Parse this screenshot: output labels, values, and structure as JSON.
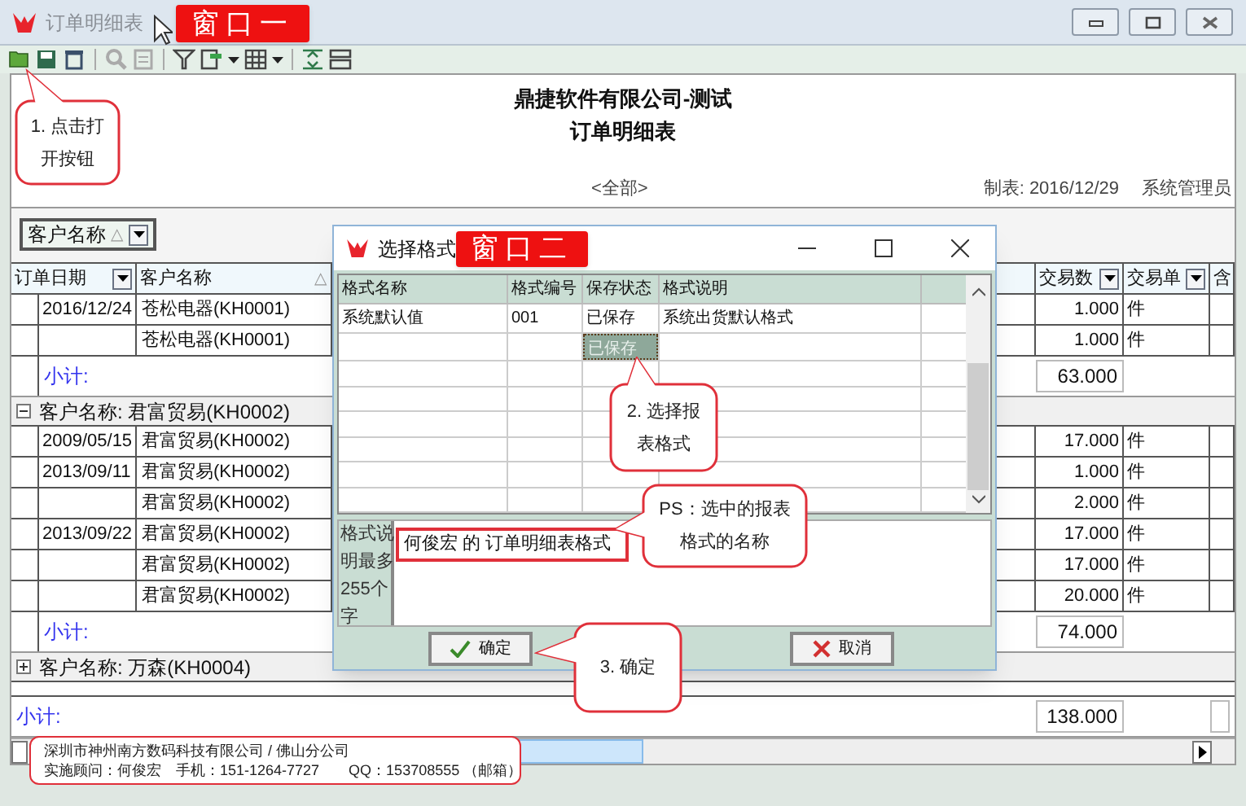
{
  "window": {
    "title": "订单明细表",
    "label": "窗口一"
  },
  "report": {
    "company": "鼎捷软件有限公司-测试",
    "title": "订单明细表",
    "filter": "<全部>",
    "prepared": "制表: 2016/12/29",
    "user": "系统管理员"
  },
  "group_by": {
    "field": "客户名称",
    "sort_mark": "△",
    "dropdown": true
  },
  "table": {
    "columns": [
      {
        "label": "订单日期",
        "dropdown": true
      },
      {
        "label": "客户名称",
        "sort_mark": "△",
        "dropdown": false
      },
      {
        "label": "交易数",
        "dropdown": true
      },
      {
        "label": "交易单",
        "dropdown": true
      },
      {
        "label": "含",
        "dropdown": false
      }
    ],
    "rows": [
      {
        "kind": "item",
        "date": "2016/12/24",
        "customer": "苍松电器(KH0001)",
        "qty": "1.000",
        "unit": "件"
      },
      {
        "kind": "item",
        "customer": "苍松电器(KH0001)",
        "qty": "1.000",
        "unit": "件"
      },
      {
        "kind": "subtotal",
        "label": "小计:",
        "qty": "63.000"
      },
      {
        "kind": "group",
        "label": "客户名称: 君富贸易(KH0002)",
        "expanded": true
      },
      {
        "kind": "item",
        "date": "2009/05/15",
        "customer": "君富贸易(KH0002)",
        "qty": "17.000",
        "unit": "件"
      },
      {
        "kind": "item",
        "date": "2013/09/11",
        "customer": "君富贸易(KH0002)",
        "qty": "1.000",
        "unit": "件"
      },
      {
        "kind": "item",
        "customer": "君富贸易(KH0002)",
        "qty": "2.000",
        "unit": "件"
      },
      {
        "kind": "item",
        "date": "2013/09/22",
        "customer": "君富贸易(KH0002)",
        "qty": "17.000",
        "unit": "件"
      },
      {
        "kind": "item",
        "customer": "君富贸易(KH0002)",
        "qty": "17.000",
        "unit": "件"
      },
      {
        "kind": "item",
        "customer": "君富贸易(KH0002)",
        "qty": "20.000",
        "unit": "件"
      },
      {
        "kind": "subtotal",
        "label": "小计:",
        "qty": "74.000"
      },
      {
        "kind": "group",
        "label": "客户名称: 万森(KH0004)",
        "expanded": false
      },
      {
        "kind": "blank"
      },
      {
        "kind": "total",
        "label": "小计:",
        "qty": "138.000"
      }
    ]
  },
  "dialog": {
    "title": "选择格式",
    "label": "窗口二",
    "columns": [
      "格式名称",
      "格式编号",
      "保存状态",
      "格式说明"
    ],
    "rows": [
      {
        "name": "系统默认值",
        "code": "001",
        "status": "已保存",
        "description": "系统出货默认格式",
        "selected": false
      },
      {
        "status": "已保存",
        "selected": true
      }
    ],
    "description_label": [
      "格式说",
      "明最多",
      "255个",
      "字"
    ],
    "description_value": "何俊宏 的 订单明细表格式",
    "buttons": [
      {
        "kind": "ok",
        "label": "确定"
      },
      {
        "kind": "cancel",
        "label": "取消"
      }
    ]
  },
  "callouts": [
    {
      "lines": [
        "1. 点击打",
        "开按钮"
      ]
    },
    {
      "lines": [
        "2. 选择报",
        "表格式"
      ]
    },
    {
      "lines": [
        "PS：选中的报表",
        "格式的名称"
      ]
    },
    {
      "lines": [
        "3. 确定"
      ]
    }
  ],
  "footer_note": {
    "lines": [
      "深圳市神州南方数码科技有限公司 / 佛山分公司",
      "实施顾问：何俊宏　手机：151-1264-7727　　QQ：153708555 （邮箱）"
    ]
  }
}
